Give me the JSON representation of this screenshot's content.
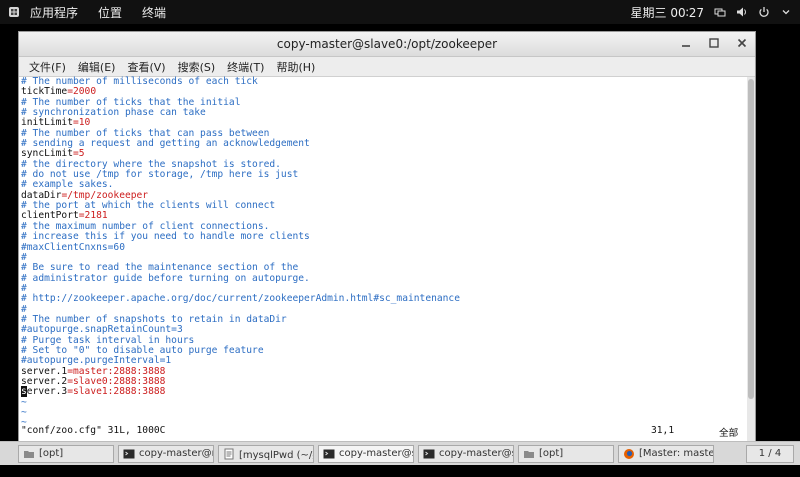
{
  "top_panel": {
    "apps": "应用程序",
    "places": "位置",
    "terminal": "终端",
    "clock": "星期三 00∶27"
  },
  "window": {
    "title": "copy-master@slave0:/opt/zookeeper"
  },
  "menubar": [
    "文件(F)",
    "编辑(E)",
    "查看(V)",
    "搜索(S)",
    "终端(T)",
    "帮助(H)"
  ],
  "terminal": {
    "lines": [
      [
        {
          "c": "cmt",
          "t": "# The number of milliseconds of each tick"
        }
      ],
      [
        {
          "c": "",
          "t": "tickTime"
        },
        {
          "c": "red",
          "t": "=2000"
        }
      ],
      [
        {
          "c": "cmt",
          "t": "# The number of ticks that the initial"
        }
      ],
      [
        {
          "c": "cmt",
          "t": "# synchronization phase can take"
        }
      ],
      [
        {
          "c": "",
          "t": "initLimit"
        },
        {
          "c": "red",
          "t": "=10"
        }
      ],
      [
        {
          "c": "cmt",
          "t": "# The number of ticks that can pass between"
        }
      ],
      [
        {
          "c": "cmt",
          "t": "# sending a request and getting an acknowledgement"
        }
      ],
      [
        {
          "c": "",
          "t": "syncLimit"
        },
        {
          "c": "red",
          "t": "=5"
        }
      ],
      [
        {
          "c": "cmt",
          "t": "# the directory where the snapshot is stored."
        }
      ],
      [
        {
          "c": "cmt",
          "t": "# do not use /tmp for storage, /tmp here is just"
        }
      ],
      [
        {
          "c": "cmt",
          "t": "# example sakes."
        }
      ],
      [
        {
          "c": "",
          "t": "dataDir"
        },
        {
          "c": "red",
          "t": "=/tmp/zookeeper"
        }
      ],
      [
        {
          "c": "cmt",
          "t": "# the port at which the clients will connect"
        }
      ],
      [
        {
          "c": "",
          "t": "clientPort"
        },
        {
          "c": "red",
          "t": "=2181"
        }
      ],
      [
        {
          "c": "cmt",
          "t": "# the maximum number of client connections."
        }
      ],
      [
        {
          "c": "cmt",
          "t": "# increase this if you need to handle more clients"
        }
      ],
      [
        {
          "c": "cmt",
          "t": "#maxClientCnxns=60"
        }
      ],
      [
        {
          "c": "cmt",
          "t": "#"
        }
      ],
      [
        {
          "c": "cmt",
          "t": "# Be sure to read the maintenance section of the"
        }
      ],
      [
        {
          "c": "cmt",
          "t": "# administrator guide before turning on autopurge."
        }
      ],
      [
        {
          "c": "cmt",
          "t": "#"
        }
      ],
      [
        {
          "c": "cmt",
          "t": "# http://zookeeper.apache.org/doc/current/zookeeperAdmin.html#sc_maintenance"
        }
      ],
      [
        {
          "c": "cmt",
          "t": "#"
        }
      ],
      [
        {
          "c": "cmt",
          "t": "# The number of snapshots to retain in dataDir"
        }
      ],
      [
        {
          "c": "cmt",
          "t": "#autopurge.snapRetainCount=3"
        }
      ],
      [
        {
          "c": "cmt",
          "t": "# Purge task interval in hours"
        }
      ],
      [
        {
          "c": "cmt",
          "t": "# Set to \"0\" to disable auto purge feature"
        }
      ],
      [
        {
          "c": "cmt",
          "t": "#autopurge.purgeInterval=1"
        }
      ],
      [
        {
          "c": "",
          "t": "server.1"
        },
        {
          "c": "red",
          "t": "=master:2888:3888"
        }
      ],
      [
        {
          "c": "",
          "t": "server.2"
        },
        {
          "c": "red",
          "t": "=slave0:2888:3888"
        }
      ],
      [
        {
          "c": "cursor",
          "t": "s"
        },
        {
          "c": "",
          "t": "erver.3"
        },
        {
          "c": "red",
          "t": "=slave1:2888:3888"
        }
      ],
      [
        {
          "c": "tilde",
          "t": "~"
        }
      ],
      [
        {
          "c": "tilde",
          "t": "~"
        }
      ],
      [
        {
          "c": "tilde",
          "t": "~"
        }
      ]
    ],
    "status_file": "\"conf/zoo.cfg\" 31L, 1000C",
    "status_pos": "31,1",
    "status_all": "全部"
  },
  "taskbar": {
    "tasks": [
      {
        "label": "[opt]",
        "icon": "folder-icon",
        "active": false
      },
      {
        "label": "copy-master@mast…",
        "icon": "terminal-icon",
        "active": false
      },
      {
        "label": "[mysqlPwd (~/桌面)",
        "icon": "text-editor-icon",
        "active": false
      },
      {
        "label": "copy-master@slave…",
        "icon": "terminal-icon",
        "active": true
      },
      {
        "label": "copy-master@slave…",
        "icon": "terminal-icon",
        "active": false
      },
      {
        "label": "[opt]",
        "icon": "folder-icon",
        "active": false
      },
      {
        "label": "[Master: master - M…",
        "icon": "firefox-icon",
        "active": false
      }
    ],
    "pager": "1 / 4"
  },
  "colors": {
    "comment": "#2d6ec3",
    "value": "#cc1d1d"
  }
}
